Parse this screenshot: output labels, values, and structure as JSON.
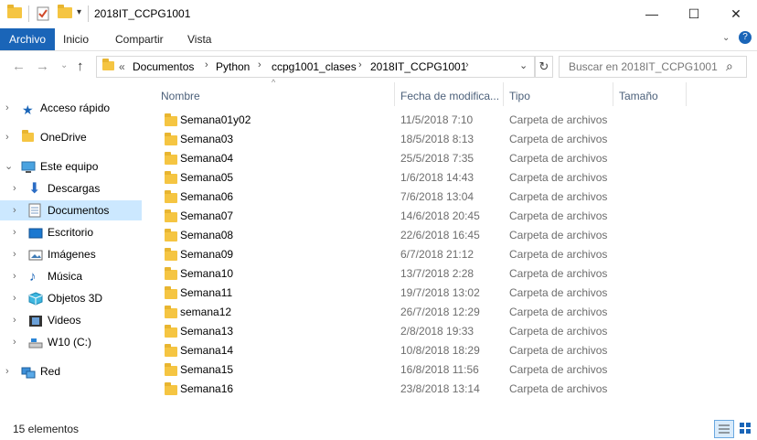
{
  "window": {
    "title": "2018IT_CCPG1001",
    "minimize": "—",
    "maximize": "☐",
    "close": "✕"
  },
  "ribbon": {
    "tabs": [
      {
        "label": "Archivo",
        "active": true
      },
      {
        "label": "Inicio",
        "active": false
      },
      {
        "label": "Compartir",
        "active": false
      },
      {
        "label": "Vista",
        "active": false
      }
    ]
  },
  "address": {
    "prefix": "«",
    "crumbs": [
      "Documentos",
      "Python",
      "ccpg1001_clases",
      "2018IT_CCPG1001"
    ],
    "separator": "›"
  },
  "search": {
    "placeholder": "Buscar en 2018IT_CCPG1001"
  },
  "nav": {
    "items": [
      {
        "label": "Acceso rápido",
        "icon": "star-icon",
        "level": 0,
        "selected": false
      },
      {
        "label": "OneDrive",
        "icon": "folder-icon",
        "level": 0,
        "selected": false
      },
      {
        "label": "Este equipo",
        "icon": "computer-icon",
        "level": 0,
        "selected": false,
        "expanded": true
      },
      {
        "label": "Descargas",
        "icon": "download-icon",
        "level": 1,
        "selected": false
      },
      {
        "label": "Documentos",
        "icon": "document-icon",
        "level": 1,
        "selected": true
      },
      {
        "label": "Escritorio",
        "icon": "desktop-icon",
        "level": 1,
        "selected": false
      },
      {
        "label": "Imágenes",
        "icon": "pictures-icon",
        "level": 1,
        "selected": false
      },
      {
        "label": "Música",
        "icon": "music-icon",
        "level": 1,
        "selected": false
      },
      {
        "label": "Objetos 3D",
        "icon": "cube-icon",
        "level": 1,
        "selected": false
      },
      {
        "label": "Videos",
        "icon": "film-icon",
        "level": 1,
        "selected": false
      },
      {
        "label": "W10 (C:)",
        "icon": "drive-icon",
        "level": 1,
        "selected": false
      },
      {
        "label": "Red",
        "icon": "network-icon",
        "level": 0,
        "selected": false
      }
    ]
  },
  "columns": {
    "name": "Nombre",
    "date": "Fecha de modifica...",
    "type": "Tipo",
    "size": "Tamaño"
  },
  "files": [
    {
      "name": "Semana01y02",
      "date": "11/5/2018 7:10",
      "type": "Carpeta de archivos"
    },
    {
      "name": "Semana03",
      "date": "18/5/2018 8:13",
      "type": "Carpeta de archivos"
    },
    {
      "name": "Semana04",
      "date": "25/5/2018 7:35",
      "type": "Carpeta de archivos"
    },
    {
      "name": "Semana05",
      "date": "1/6/2018 14:43",
      "type": "Carpeta de archivos"
    },
    {
      "name": "Semana06",
      "date": "7/6/2018 13:04",
      "type": "Carpeta de archivos"
    },
    {
      "name": "Semana07",
      "date": "14/6/2018 20:45",
      "type": "Carpeta de archivos"
    },
    {
      "name": "Semana08",
      "date": "22/6/2018 16:45",
      "type": "Carpeta de archivos"
    },
    {
      "name": "Semana09",
      "date": "6/7/2018 21:12",
      "type": "Carpeta de archivos"
    },
    {
      "name": "Semana10",
      "date": "13/7/2018 2:28",
      "type": "Carpeta de archivos"
    },
    {
      "name": "Semana11",
      "date": "19/7/2018 13:02",
      "type": "Carpeta de archivos"
    },
    {
      "name": "semana12",
      "date": "26/7/2018 12:29",
      "type": "Carpeta de archivos"
    },
    {
      "name": "Semana13",
      "date": "2/8/2018 19:33",
      "type": "Carpeta de archivos"
    },
    {
      "name": "Semana14",
      "date": "10/8/2018 18:29",
      "type": "Carpeta de archivos"
    },
    {
      "name": "Semana15",
      "date": "16/8/2018 11:56",
      "type": "Carpeta de archivos"
    },
    {
      "name": "Semana16",
      "date": "23/8/2018 13:14",
      "type": "Carpeta de archivos"
    }
  ],
  "status": {
    "count": "15 elementos"
  },
  "colors": {
    "accent": "#1a65b8",
    "selection": "#cce8ff",
    "folder": "#f5c542",
    "header_text": "#4c607a"
  }
}
